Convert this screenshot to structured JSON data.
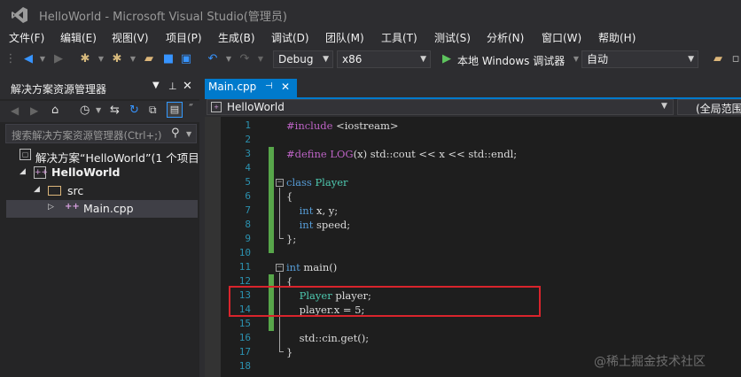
{
  "window": {
    "title": "HelloWorld - Microsoft Visual Studio(管理员)"
  },
  "menu": [
    "文件(F)",
    "编辑(E)",
    "视图(V)",
    "项目(P)",
    "生成(B)",
    "调试(D)",
    "团队(M)",
    "工具(T)",
    "测试(S)",
    "分析(N)",
    "窗口(W)",
    "帮助(H)"
  ],
  "toolbar": {
    "config": "Debug",
    "platform": "x86",
    "run_label": "本地 Windows 调试器",
    "mode": "自动"
  },
  "solution_explorer": {
    "title": "解决方案资源管理器",
    "search_placeholder": "搜索解决方案资源管理器(Ctrl+;)",
    "tree": [
      {
        "label": "解决方案“HelloWorld”(1 个项目)",
        "icon": "solution-icon"
      },
      {
        "label": "HelloWorld",
        "icon": "project-icon",
        "bold": true
      },
      {
        "label": "src",
        "icon": "folder-icon"
      },
      {
        "label": "Main.cpp",
        "icon": "cpp-file-icon"
      }
    ]
  },
  "editor": {
    "tab_label": "Main.cpp",
    "nav_left": "HelloWorld",
    "nav_right": "(全局范围",
    "lines": [
      "1",
      "2",
      "3",
      "4",
      "5",
      "6",
      "7",
      "8",
      "9",
      "10",
      "11",
      "12",
      "13",
      "14",
      "15",
      "16",
      "17",
      "18"
    ]
  },
  "watermark": "@稀土掘金技术社区",
  "colors": {
    "accent": "#007acc",
    "highlight_box": "#d9242c",
    "change_bar": "#57a64a"
  }
}
